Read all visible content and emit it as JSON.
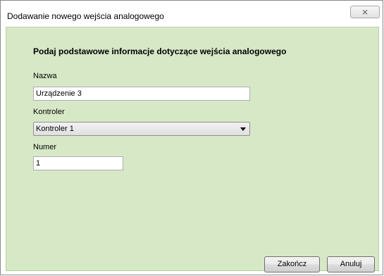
{
  "window": {
    "title": "Dodawanie nowego wejścia analogowego",
    "close_glyph": "⨯"
  },
  "form": {
    "heading": "Podaj podstawowe informacje dotyczące wejścia analogowego",
    "name_label": "Nazwa",
    "name_value": "Urządzenie 3",
    "controller_label": "Kontroler",
    "controller_value": "Kontroler 1",
    "number_label": "Numer",
    "number_value": "1"
  },
  "buttons": {
    "finish": "Zakończ",
    "cancel": "Anuluj"
  },
  "colors": {
    "content_background": "#d7e8c7"
  }
}
